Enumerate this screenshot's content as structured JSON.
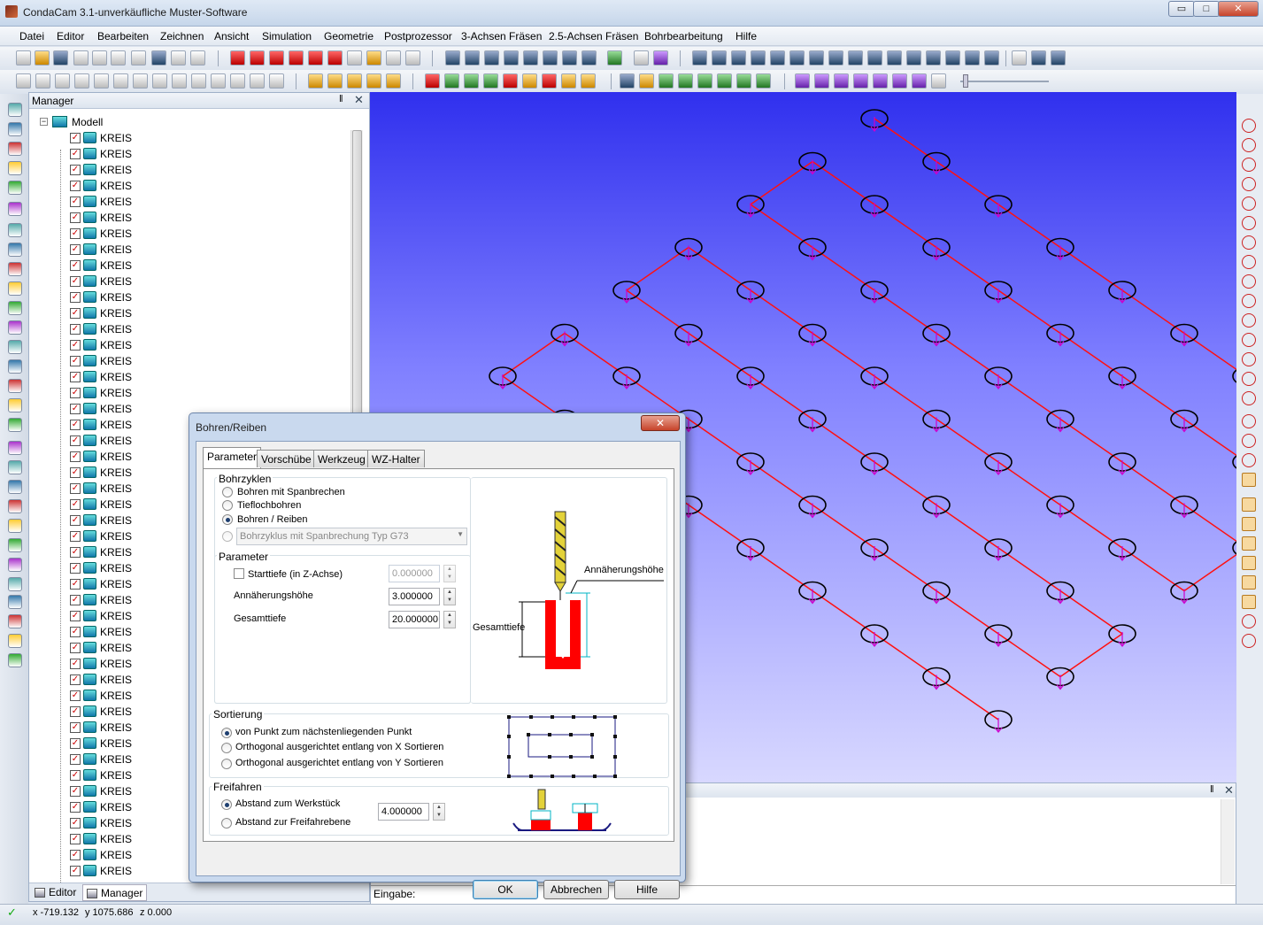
{
  "app": {
    "title": "CondaCam 3.1-unverkäufliche Muster-Software"
  },
  "window_controls": {
    "minimize": "▭",
    "maximize": "□",
    "close": "✕"
  },
  "menu": [
    "Datei",
    "Editor",
    "Bearbeiten",
    "Zeichnen",
    "Ansicht",
    "Simulation",
    "Geometrie",
    "Postprozessor",
    "3-Achsen Fräsen",
    "2.5-Achsen Fräsen",
    "Bohrbearbeitung",
    "Hilfe"
  ],
  "manager": {
    "title": "Manager",
    "pin": "‖",
    "close": "✕",
    "root": {
      "label": "Modell",
      "toggle": "−"
    },
    "item_label": "KREIS",
    "item_count": 47,
    "tabs": [
      {
        "label": "Editor"
      },
      {
        "label": "Manager"
      }
    ]
  },
  "output": {
    "pin": "‖",
    "close": "✕",
    "input_label": "Eingabe:"
  },
  "status": {
    "check": "✓",
    "x": "x -719.132",
    "y": "y 1075.686",
    "z": "z 0.000"
  },
  "colors": {
    "path_line": "#ff1010",
    "hole_outline": "#000000",
    "hole_marker": "#cc00cc"
  },
  "dialog": {
    "title": "Bohren/Reiben",
    "close": "✕",
    "tabs": [
      {
        "label": "Parameter",
        "active": true
      },
      {
        "label": "Vorschübe"
      },
      {
        "label": "Werkzeug"
      },
      {
        "label": "WZ-Halter"
      }
    ],
    "bohrzyklen": {
      "label": "Bohrzyklen",
      "options": [
        "Bohren mit Spanbrechen",
        "Tieflochbohren",
        "Bohren / Reiben"
      ],
      "selected_index": 2,
      "combo_value": "Bohrzyklus mit Spanbrechung  Typ G73"
    },
    "parameter": {
      "label": "Parameter",
      "starttiefe_label": "Starttiefe (in Z-Achse)",
      "starttiefe_value": "0.000000",
      "annaeherung_label": "Annäherungshöhe",
      "annaeherung_value": "3.000000",
      "gesamttiefe_label": "Gesamttiefe",
      "gesamttiefe_value": "20.000000"
    },
    "diagram": {
      "annaeherung": "Annäherungshöhe",
      "gesamttiefe": "Gesamttiefe"
    },
    "sortierung": {
      "label": "Sortierung",
      "options": [
        "von Punkt zum nächstenliegenden Punkt",
        "Orthogonal ausgerichtet entlang von X Sortieren",
        "Orthogonal ausgerichtet entlang von Y Sortieren"
      ],
      "selected_index": 0
    },
    "freifahren": {
      "label": "Freifahren",
      "options": [
        "Abstand zum Werkstück",
        "Abstand zur Freifahrebene"
      ],
      "selected_index": 0,
      "value": "4.000000"
    },
    "buttons": {
      "ok": "OK",
      "cancel": "Abbrechen",
      "help": "Hilfe"
    }
  }
}
